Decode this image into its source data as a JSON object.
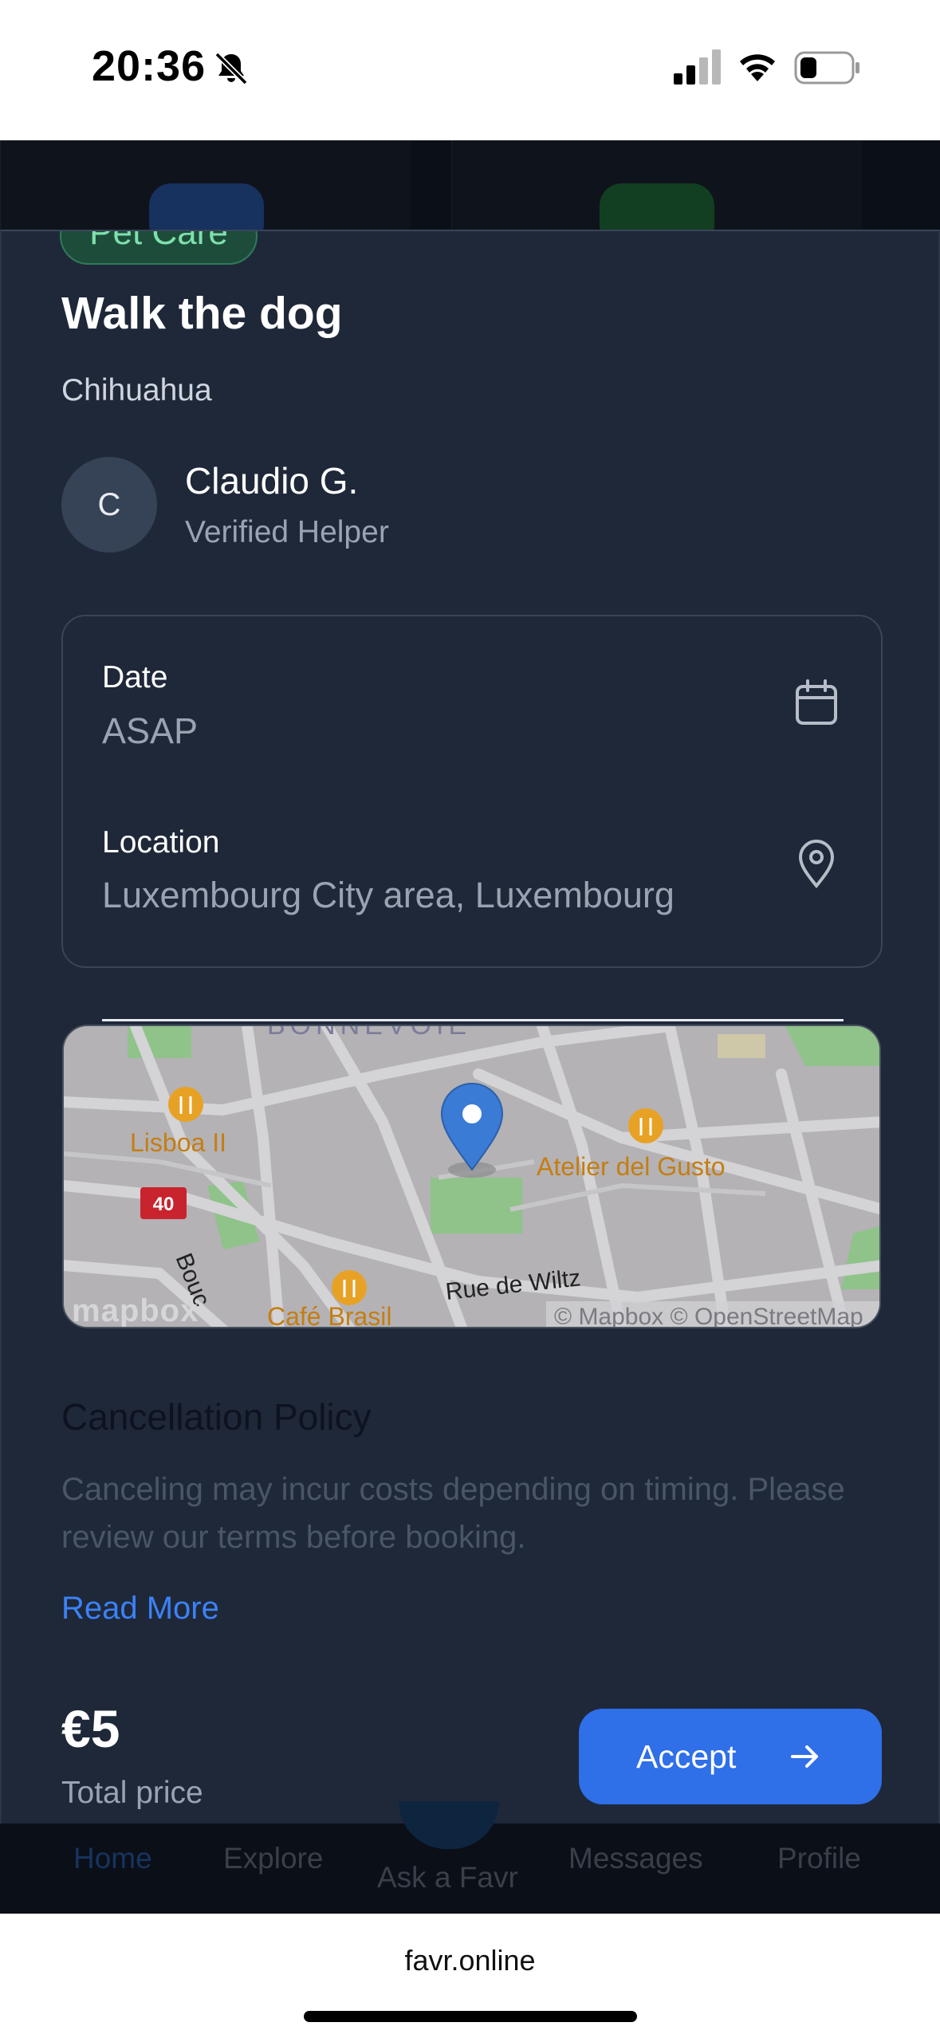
{
  "status_bar": {
    "time": "20:36",
    "icons": [
      "bell-slash-icon",
      "cellular-signal-icon",
      "wifi-icon",
      "battery-icon"
    ]
  },
  "task": {
    "category": "Pet Care",
    "title": "Walk the dog",
    "subtitle": "Chihuahua"
  },
  "helper": {
    "initial": "C",
    "name": "Claudio G.",
    "role": "Verified Helper"
  },
  "details": {
    "date_label": "Date",
    "date_value": "ASAP",
    "location_label": "Location",
    "location_value": "Luxembourg City area, Luxembourg"
  },
  "map": {
    "labels": {
      "district": "BONNEVOIE",
      "poi_1": "Lisboa II",
      "poi_2": "Atelier del Gusto",
      "poi_3": "Café Brasil",
      "street_1": "Rue de Wiltz",
      "street_2": "Bouc",
      "route_shield": "40"
    },
    "logo": "mapbox",
    "attribution": "© Mapbox © OpenStreetMap"
  },
  "policy": {
    "title": "Cancellation Policy",
    "text": "Canceling may incur costs depending on timing. Please review our terms before booking.",
    "link": "Read More"
  },
  "footer": {
    "price": "€5",
    "price_label": "Total price",
    "accept_label": "Accept"
  },
  "bottom_nav": {
    "home": "Home",
    "explore": "Explore",
    "ask": "Ask a Favr",
    "messages": "Messages",
    "profile": "Profile"
  },
  "browser": {
    "url": "favr.online"
  },
  "colors": {
    "sheet_bg": "#1f2839",
    "accent": "#2f6fe8",
    "link": "#3b82f6",
    "category_bg": "#1d4d3a"
  }
}
